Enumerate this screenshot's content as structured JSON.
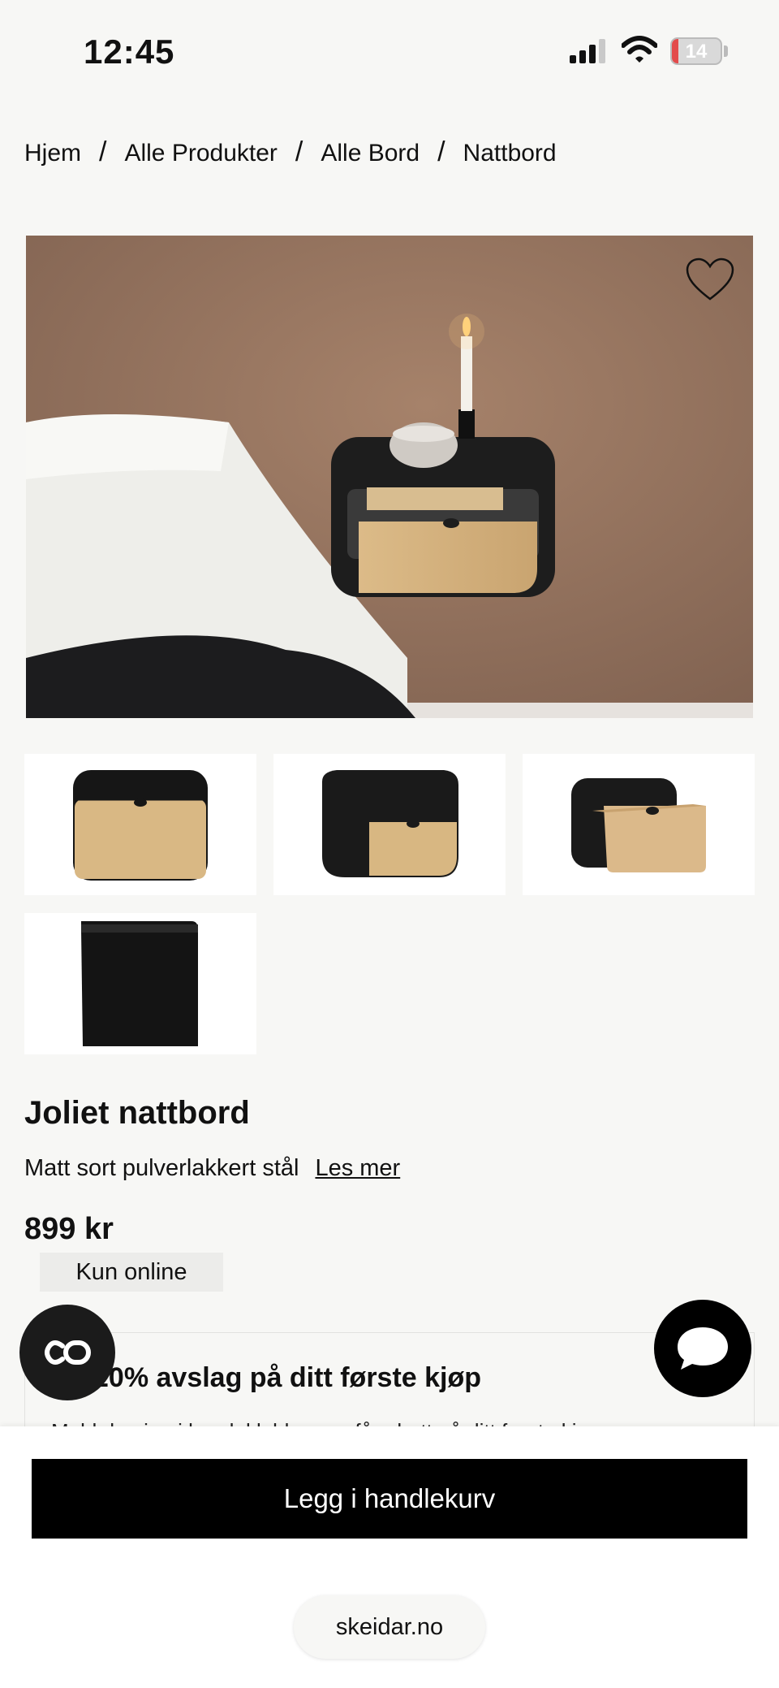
{
  "status_bar": {
    "time": "12:45",
    "battery": "14",
    "battery_level": 0.14
  },
  "breadcrumb": {
    "items": [
      "Hjem",
      "Alle Produkter",
      "Alle Bord",
      "Nattbord"
    ],
    "separator": "/"
  },
  "product": {
    "title": "Joliet nattbord",
    "description": "Matt sort pulverlakkert stål",
    "read_more": "Les mer",
    "price": "899 kr",
    "badge": "Kun online",
    "gallery_icons": [
      "favorite-heart-icon"
    ],
    "thumbnail_count": 4
  },
  "promo": {
    "title": "20% avslag på ditt første kjøp",
    "line": "Meld deg inn i kundeklubben og få rabatt på ditt første kjøp"
  },
  "actions": {
    "add_to_cart": "Legg i handlekurv"
  },
  "browser": {
    "url": "skeidar.no"
  },
  "colors": {
    "accent": "#000000",
    "battery_low": "#e34b4b",
    "background": "#f7f7f5",
    "badge_bg": "#ececea"
  }
}
